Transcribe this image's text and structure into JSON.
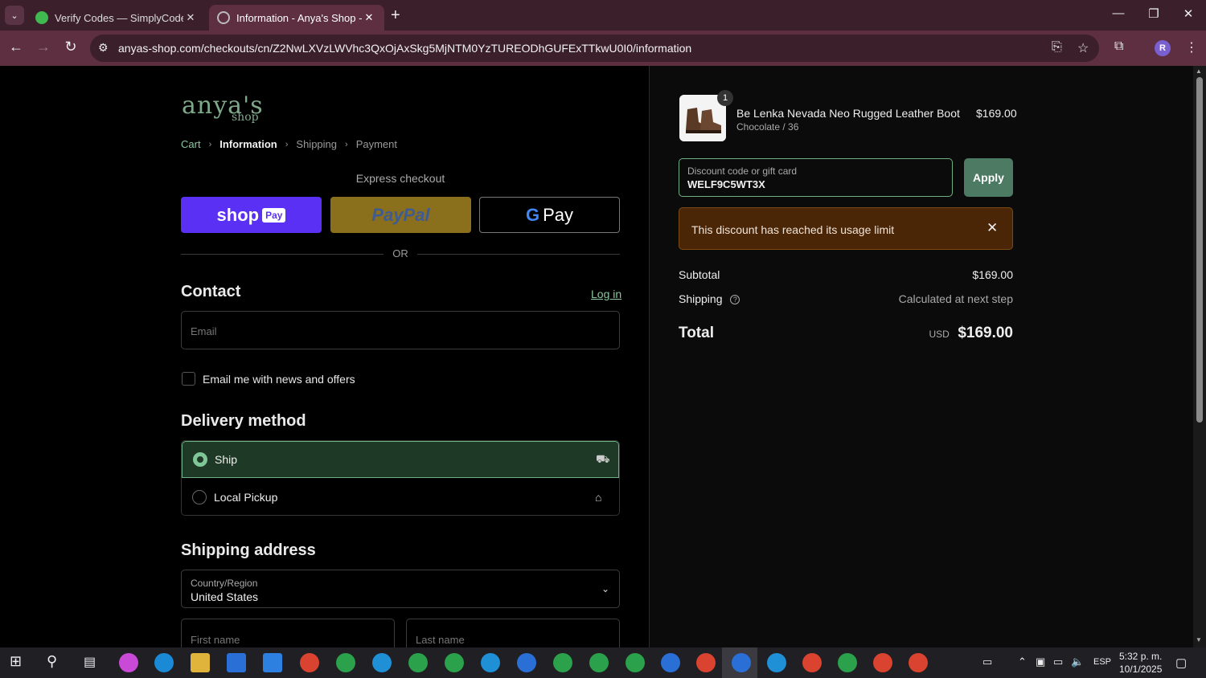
{
  "browser": {
    "tabs": [
      {
        "title": "Verify Codes — SimplyCodes",
        "active": false
      },
      {
        "title": "Information - Anya's Shop - Ch",
        "active": true
      }
    ],
    "url": "anyas-shop.com/checkouts/cn/Z2NwLXVzLWVhc3QxOjAxSkg5MjNTM0YzTUREODhGUFExTTkwU0I0/information",
    "profile_initial": "R"
  },
  "logo": {
    "main": "anya's",
    "sub": "shop"
  },
  "breadcrumb": [
    "Cart",
    "Information",
    "Shipping",
    "Payment"
  ],
  "express": {
    "label": "Express checkout",
    "shop_pay": "shop",
    "shop_pay_badge": "Pay",
    "paypal": "PayPal",
    "gpay_g": "G",
    "gpay": "Pay",
    "or": "OR"
  },
  "contact": {
    "heading": "Contact",
    "login": "Log in",
    "email_placeholder": "Email",
    "newsletter": "Email me with news and offers"
  },
  "delivery": {
    "heading": "Delivery method",
    "options": [
      {
        "label": "Ship",
        "selected": true,
        "icon": "truck-icon"
      },
      {
        "label": "Local Pickup",
        "selected": false,
        "icon": "store-icon"
      }
    ]
  },
  "shipping_address": {
    "heading": "Shipping address",
    "country_label": "Country/Region",
    "country_value": "United States",
    "first_name_placeholder": "First name",
    "last_name_placeholder": "Last name"
  },
  "order": {
    "quantity": "1",
    "product_name": "Be Lenka Nevada Neo Rugged Leather Boot",
    "variant": "Chocolate / 36",
    "price": "$169.00",
    "discount_label": "Discount code or gift card",
    "discount_value": "WELF9C5WT3X",
    "apply": "Apply",
    "alert": "This discount has reached its usage limit",
    "subtotal_label": "Subtotal",
    "subtotal": "$169.00",
    "shipping_label": "Shipping",
    "shipping_value": "Calculated at next step",
    "total_label": "Total",
    "currency": "USD",
    "total": "$169.00"
  },
  "taskbar": {
    "language": "ESP",
    "time": "5:32 p. m.",
    "date": "10/1/2025"
  },
  "colors": {
    "accent_green": "#6fb184",
    "shop_pay": "#5a31f4",
    "alert_bg": "#4a2606",
    "chrome": "#5d2f40"
  }
}
